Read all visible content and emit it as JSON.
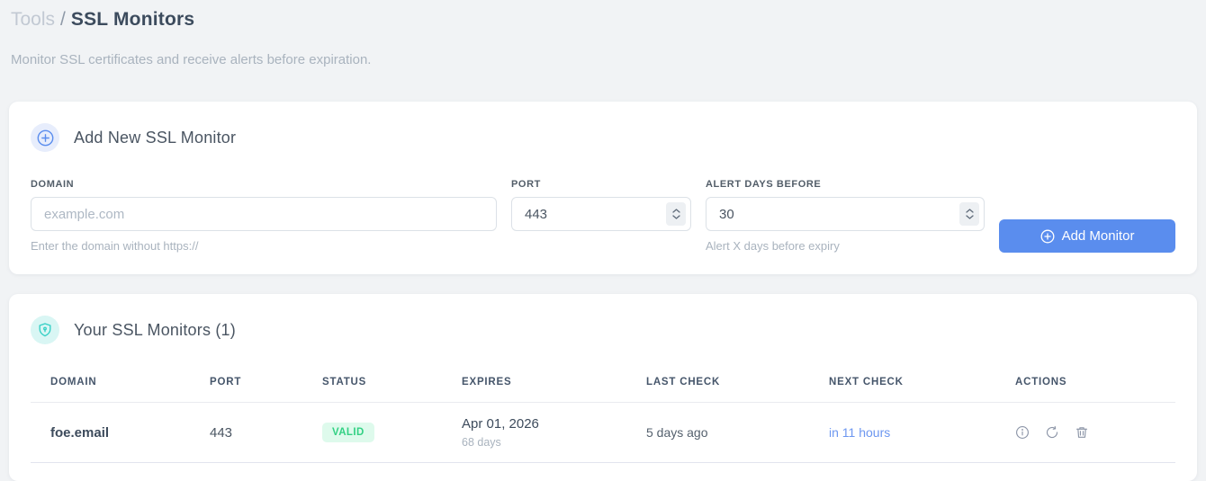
{
  "breadcrumb": {
    "section": "Tools",
    "separator": "/",
    "current": "SSL Monitors"
  },
  "subtitle": "Monitor SSL certificates and receive alerts before expiration.",
  "add_monitor_card": {
    "title": "Add New SSL Monitor",
    "fields": {
      "domain": {
        "label": "DOMAIN",
        "placeholder": "example.com",
        "helper": "Enter the domain without https://"
      },
      "port": {
        "label": "PORT",
        "value": "443"
      },
      "alert_days": {
        "label": "ALERT DAYS BEFORE",
        "value": "30",
        "helper": "Alert X days before expiry"
      }
    },
    "submit_label": "Add Monitor"
  },
  "monitors_card": {
    "title": "Your SSL Monitors (1)",
    "columns": [
      "DOMAIN",
      "PORT",
      "STATUS",
      "EXPIRES",
      "LAST CHECK",
      "NEXT CHECK",
      "ACTIONS"
    ],
    "rows": [
      {
        "domain": "foe.email",
        "port": "443",
        "status": "VALID",
        "expires_date": "Apr 01, 2026",
        "expires_days": "68 days",
        "last_check": "5 days ago",
        "next_check": "in 11 hours"
      }
    ]
  },
  "icons": {
    "header_add": "circle-plus-icon",
    "monitors": "shield-lock-icon",
    "button": "circle-plus-icon",
    "row_actions": [
      "info-icon",
      "refresh-icon",
      "trash-icon"
    ]
  },
  "colors": {
    "accent_blue": "#5a8dee",
    "accent_blue_bg": "#e7edfc",
    "teal": "#35d0c5",
    "teal_bg": "#d9f6f4",
    "valid_green": "#33d184",
    "valid_green_bg": "#defaec",
    "next_check_blue": "#6d97f0"
  }
}
